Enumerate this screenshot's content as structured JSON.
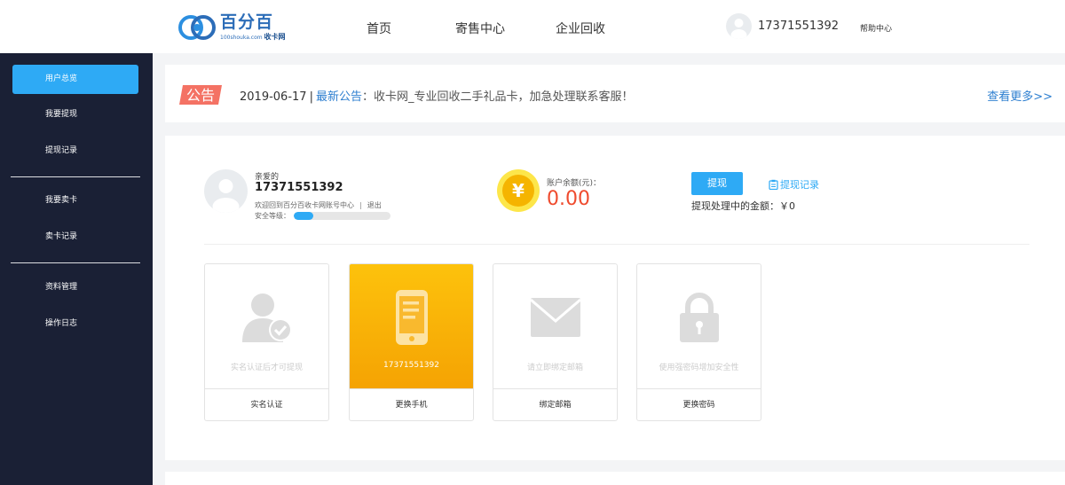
{
  "header": {
    "logo_text": "百分百",
    "logo_sub": "100shouka.com",
    "logo_sub_bold": "收卡网",
    "nav": [
      "首页",
      "寄售中心",
      "企业回收"
    ],
    "user_phone": "17371551392",
    "help": "帮助中心"
  },
  "sidebar": {
    "items": [
      "用户总览",
      "我要提现",
      "提现记录",
      "我要卖卡",
      "卖卡记录",
      "资料管理",
      "操作日志"
    ],
    "active": "用户总览",
    "colors": {
      "bg": "#1a2035",
      "active": "#2eaaf5"
    }
  },
  "notice": {
    "badge": "公告",
    "date": "2019-06-17",
    "separator": "|",
    "label": "最新公告",
    "text": "：收卡网_专业回收二手礼品卡，加急处理联系客服！",
    "more": "查看更多>>"
  },
  "account": {
    "greeting": "亲爱的",
    "username": "17371551392",
    "welcome": "欢迎回到百分百收卡网账号中心",
    "separator": "|",
    "logout": "退出",
    "security_label": "安全等级：",
    "security_level": 0.2,
    "balance_label": "账户余额(元)：",
    "balance": "0.00",
    "coin_symbol": "¥",
    "withdraw_button": "提现",
    "withdraw_records": "提现记录",
    "pending_label": "提现处理中的金额：",
    "pending_value": "￥0"
  },
  "cards": [
    {
      "icon": "user-verify-icon",
      "desc": "实名认证后才可提现",
      "action": "实名认证",
      "active": false
    },
    {
      "icon": "mobile-phone-icon",
      "desc": "17371551392",
      "action": "更换手机",
      "active": true
    },
    {
      "icon": "envelope-icon",
      "desc": "请立即绑定邮箱",
      "action": "绑定邮箱",
      "active": false
    },
    {
      "icon": "lock-icon",
      "desc": "使用强密码增加安全性",
      "action": "更换密码",
      "active": false
    }
  ],
  "colors": {
    "accent": "#2eaaf5",
    "balance": "#ef4b2e",
    "notice_badge": "#f47264",
    "card_active": "#fdc20c"
  }
}
